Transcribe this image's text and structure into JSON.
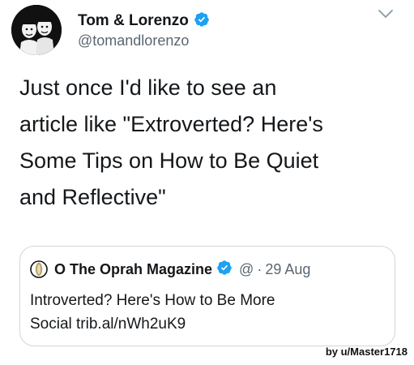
{
  "tweet": {
    "author": {
      "display_name": "Tom & Lorenzo",
      "handle": "@tomandlorenzo",
      "verified": true,
      "avatar_icon": "cartoon-duo-avatar"
    },
    "menu_icon": "chevron-down-icon",
    "text_lines": [
      "Just once I'd like to see an",
      "article like \"Extroverted? Here's",
      "Some Tips on How to Be Quiet",
      "and Reflective\""
    ]
  },
  "quoted_tweet": {
    "display_name": "O The Oprah Magazine",
    "verified": true,
    "handle": "@",
    "separator": "·",
    "date": "29 Aug",
    "text_lines": [
      "Introverted? Here's How to Be More",
      "Social trib.al/nWh2uK9"
    ],
    "logo_icon": "oprah-magazine-logo"
  },
  "watermark": "by u/Master1718",
  "colors": {
    "text": "#14171a",
    "secondary": "#5b6670",
    "verified_blue": "#1da1f2",
    "border": "#cfd6dc"
  }
}
